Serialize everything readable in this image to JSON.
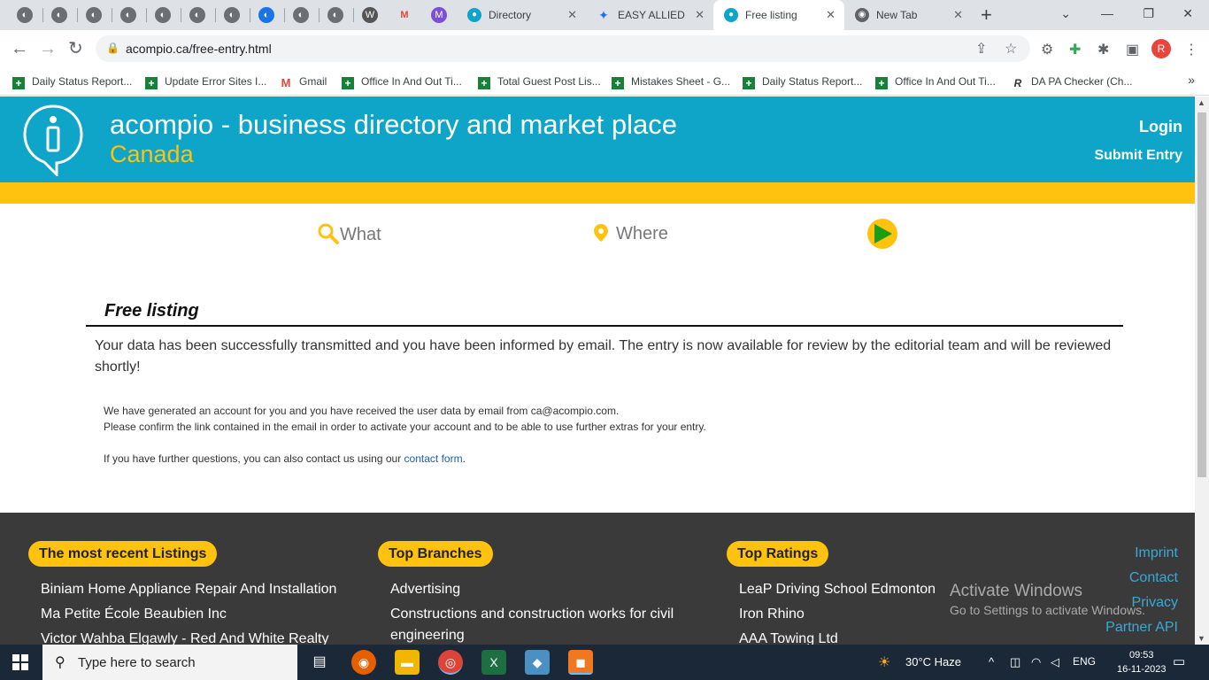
{
  "browser": {
    "tabs": [
      {
        "label": "Directory",
        "icon": "pin-icon"
      },
      {
        "label": "EASY ALLIED H",
        "icon": "star-icon"
      },
      {
        "label": "Free listing",
        "icon": "pin-icon",
        "active": true
      },
      {
        "label": "New Tab",
        "icon": "chrome-icon"
      }
    ],
    "url": "acompio.ca/free-entry.html",
    "avatar_letter": "R",
    "bookmarks": [
      "Daily Status Report...",
      "Update Error Sites I...",
      "Gmail",
      "Office In And Out Ti...",
      "Total Guest Post Lis...",
      "Mistakes Sheet - G...",
      "Daily Status Report...",
      "Office In And Out Ti...",
      "DA PA Checker (Ch..."
    ]
  },
  "site": {
    "title": "acompio  - business directory and market place",
    "country": "Canada",
    "login": "Login",
    "submit_entry": "Submit Entry",
    "search_what": "What",
    "search_where": "Where"
  },
  "content": {
    "title": "Free listing",
    "message": "Your data has been successfully transmitted and you have been informed by email. The entry is now available for review by the editorial team and will be reviewed shortly!",
    "account_line1": "We have generated an account for you and you have received the user data by email from ca@acompio.com.",
    "account_line2": "Please confirm the link contained in the email in order to activate your account and to be able to use further extras for your entry.",
    "contact_prefix": "If you have further questions, you can also contact us using our ",
    "contact_link": "contact form",
    "contact_suffix": "."
  },
  "footer": {
    "recent_title": "The most recent Listings",
    "recent": [
      "Biniam Home Appliance Repair And Installation",
      "Ma Petite École Beaubien Inc",
      "Victor Wahba Elgawly - Red And White Realty"
    ],
    "branches_title": "Top Branches",
    "branches": [
      "Advertising",
      "Constructions and construction works for civil",
      "engineering"
    ],
    "ratings_title": "Top Ratings",
    "ratings": [
      "LeaP Driving School Edmonton",
      "Iron Rhino",
      "AAA Towing Ltd"
    ],
    "links": [
      "Imprint",
      "Contact",
      "Privacy",
      "Partner API"
    ],
    "activate_title": "Activate Windows",
    "activate_sub": "Go to Settings to activate Windows."
  },
  "taskbar": {
    "search_placeholder": "Type here to search",
    "weather": "30°C  Haze",
    "language": "ENG",
    "time": "09:53",
    "date": "16-11-2023"
  },
  "colors": {
    "header": "#0ea5c9",
    "accent": "#ffc20e",
    "footer": "#3a3a3a",
    "link": "#3aa8d8"
  }
}
